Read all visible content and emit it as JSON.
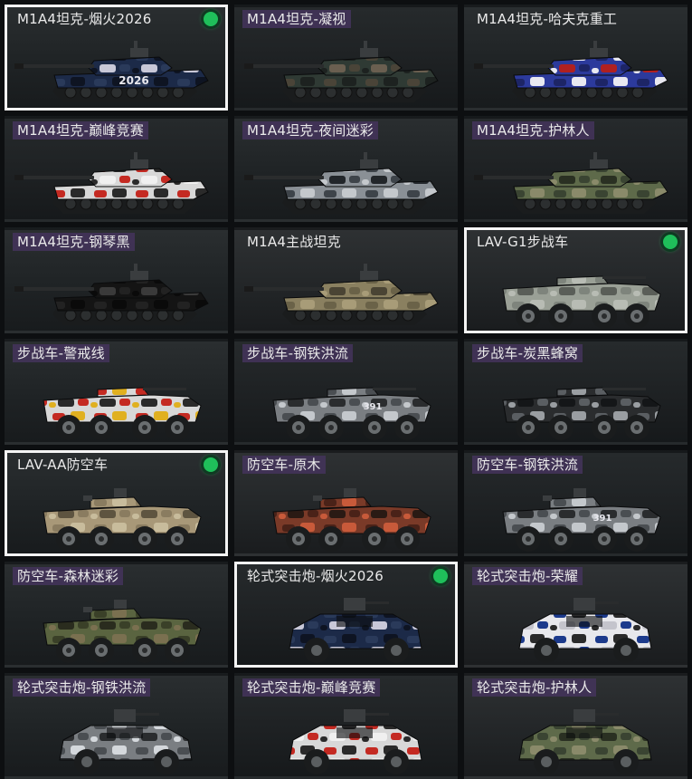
{
  "items": [
    {
      "label": "M1A4坦克-烟火2026",
      "selected": true,
      "status_dot": true,
      "type": "tank",
      "camo": "firework",
      "colors": [
        "#1c2a48",
        "#2a3a5a",
        "#0e1422",
        "#c8c8d8"
      ],
      "decal": "2026",
      "bg": "a"
    },
    {
      "label": "M1A4坦克-凝视",
      "tag": true,
      "type": "tank",
      "camo": "gaze",
      "colors": [
        "#2f3a34",
        "#4a4438",
        "#1d2220",
        "#6a5f50"
      ],
      "accent": "#9a2b26",
      "bg": "b"
    },
    {
      "label": "M1A4坦克-哈夫克重工",
      "type": "tank",
      "camo": "haavk",
      "colors": [
        "#2c3a9c",
        "#1d2566",
        "#e8e8f0",
        "#b02020"
      ],
      "bg": "a"
    },
    {
      "label": "M1A4坦克-巅峰竞赛",
      "tag": true,
      "type": "tank",
      "camo": "race",
      "colors": [
        "#d8d8d8",
        "#c42a22",
        "#2a2a2a",
        "#f0f0f0"
      ],
      "bg": "b"
    },
    {
      "label": "M1A4坦克-夜间迷彩",
      "tag": true,
      "type": "tank",
      "camo": "night",
      "colors": [
        "#8a9096",
        "#3e444a",
        "#c4c8cc",
        "#22262a"
      ],
      "bg": "a"
    },
    {
      "label": "M1A4坦克-护林人",
      "tag": true,
      "type": "tank",
      "camo": "forest",
      "colors": [
        "#5e6a4a",
        "#3a4432",
        "#8a8a6a",
        "#2a3022"
      ],
      "bg": "b"
    },
    {
      "label": "M1A4坦克-钢琴黑",
      "tag": true,
      "type": "tank",
      "camo": "piano",
      "colors": [
        "#141414",
        "#222222",
        "#0a0a0a",
        "#3a3a3a"
      ],
      "bg": "a"
    },
    {
      "label": "M1A4主战坦克",
      "type": "tank",
      "camo": "stock",
      "colors": [
        "#8a8060",
        "#6a6248",
        "#a89c78",
        "#4a4434"
      ],
      "bg": "c"
    },
    {
      "label": "LAV-G1步战车",
      "selected": true,
      "status_dot": true,
      "type": "ifv",
      "camo": "grey",
      "colors": [
        "#9aa096",
        "#7e847c",
        "#b8bcb4",
        "#5a5e58"
      ],
      "bg": "c"
    },
    {
      "label": "步战车-警戒线",
      "tag": true,
      "type": "ifv",
      "camo": "caution",
      "colors": [
        "#d8d8d8",
        "#c42a22",
        "#e0b020",
        "#2a2a2a"
      ],
      "bg": "a"
    },
    {
      "label": "步战车-钢铁洪流",
      "tag": true,
      "type": "ifv",
      "camo": "steel",
      "colors": [
        "#7a7e82",
        "#4a4e52",
        "#c4c8cc",
        "#2a2c2e"
      ],
      "decal": "391",
      "bg": "b"
    },
    {
      "label": "步战车-炭黑蜂窝",
      "tag": true,
      "type": "ifv",
      "camo": "honeycomb",
      "colors": [
        "#2a2c2e",
        "#5a5e62",
        "#9a9ea2",
        "#141618"
      ],
      "bg": "b"
    },
    {
      "label": "LAV-AA防空车",
      "selected": true,
      "status_dot": true,
      "type": "aa",
      "camo": "desert",
      "colors": [
        "#a89878",
        "#8a7c60",
        "#c8bc9c",
        "#5e5440"
      ],
      "bg": "a"
    },
    {
      "label": "防空车-原木",
      "tag": true,
      "type": "aa",
      "camo": "rust",
      "colors": [
        "#7a3a28",
        "#4a2218",
        "#c85a3a",
        "#2a1a14"
      ],
      "bg": "c"
    },
    {
      "label": "防空车-钢铁洪流",
      "tag": true,
      "type": "aa",
      "camo": "steel",
      "colors": [
        "#7a7e82",
        "#4a4e52",
        "#c4c8cc",
        "#2a2c2e"
      ],
      "decal": "391",
      "bg": "b"
    },
    {
      "label": "防空车-森林迷彩",
      "tag": true,
      "type": "aa",
      "camo": "woodland",
      "colors": [
        "#5a6440",
        "#3a4028",
        "#7a7050",
        "#2a2c1e"
      ],
      "bg": "a"
    },
    {
      "label": "轮式突击炮-烟火2026",
      "selected": true,
      "status_dot": true,
      "type": "apc",
      "camo": "firework",
      "colors": [
        "#1c2a48",
        "#2a3a5a",
        "#0e1422",
        "#c8c8d8"
      ],
      "bg": "b"
    },
    {
      "label": "轮式突击炮-荣耀",
      "tag": true,
      "type": "apc",
      "camo": "glory",
      "colors": [
        "#e8e8ec",
        "#1c3a8c",
        "#2a2a2a",
        "#c4c4cc"
      ],
      "bg": "c"
    },
    {
      "label": "轮式突击炮-钢铁洪流",
      "tag": true,
      "type": "apc",
      "camo": "steel",
      "colors": [
        "#7a7e82",
        "#4a4e52",
        "#d4d8dc",
        "#2a2c2e"
      ],
      "bg": "a"
    },
    {
      "label": "轮式突击炮-巅峰竞赛",
      "tag": true,
      "type": "apc",
      "camo": "race",
      "colors": [
        "#d8d8d8",
        "#c42a22",
        "#2a2a2a",
        "#f0f0f0"
      ],
      "bg": "b"
    },
    {
      "label": "轮式突击炮-护林人",
      "tag": true,
      "type": "apc",
      "camo": "forest",
      "colors": [
        "#5e6a4a",
        "#3a4432",
        "#8a8a6a",
        "#2a3022"
      ],
      "bg": "c"
    }
  ]
}
